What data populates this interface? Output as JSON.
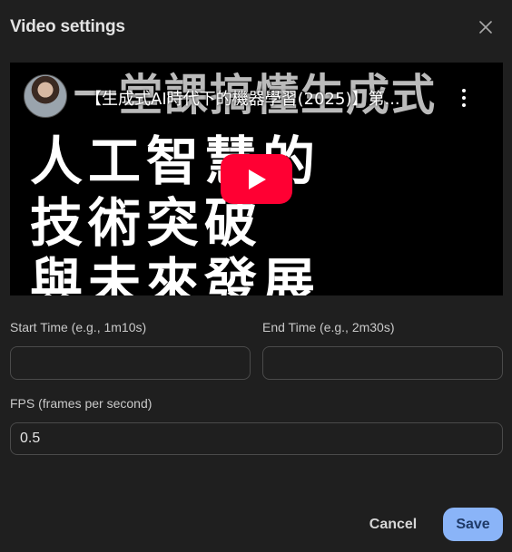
{
  "dialog": {
    "title": "Video settings",
    "close_icon": "close-icon"
  },
  "video": {
    "title": "【生成式AI時代下的機器學習(2025)】第...",
    "thumbnail_lines": [
      "一堂課搞懂生成式",
      "人工智慧的",
      "技術突破",
      "與未來發展"
    ],
    "play_icon": "play-icon",
    "menu_icon": "more-vert-icon",
    "brand_color": "#ff0033"
  },
  "start_time": {
    "label": "Start Time (e.g., 1m10s)",
    "value": ""
  },
  "end_time": {
    "label": "End Time (e.g., 2m30s)",
    "value": ""
  },
  "fps": {
    "label": "FPS (frames per second)",
    "value": "0.5"
  },
  "actions": {
    "cancel_label": "Cancel",
    "save_label": "Save",
    "accent_color": "#8ab4f8"
  }
}
